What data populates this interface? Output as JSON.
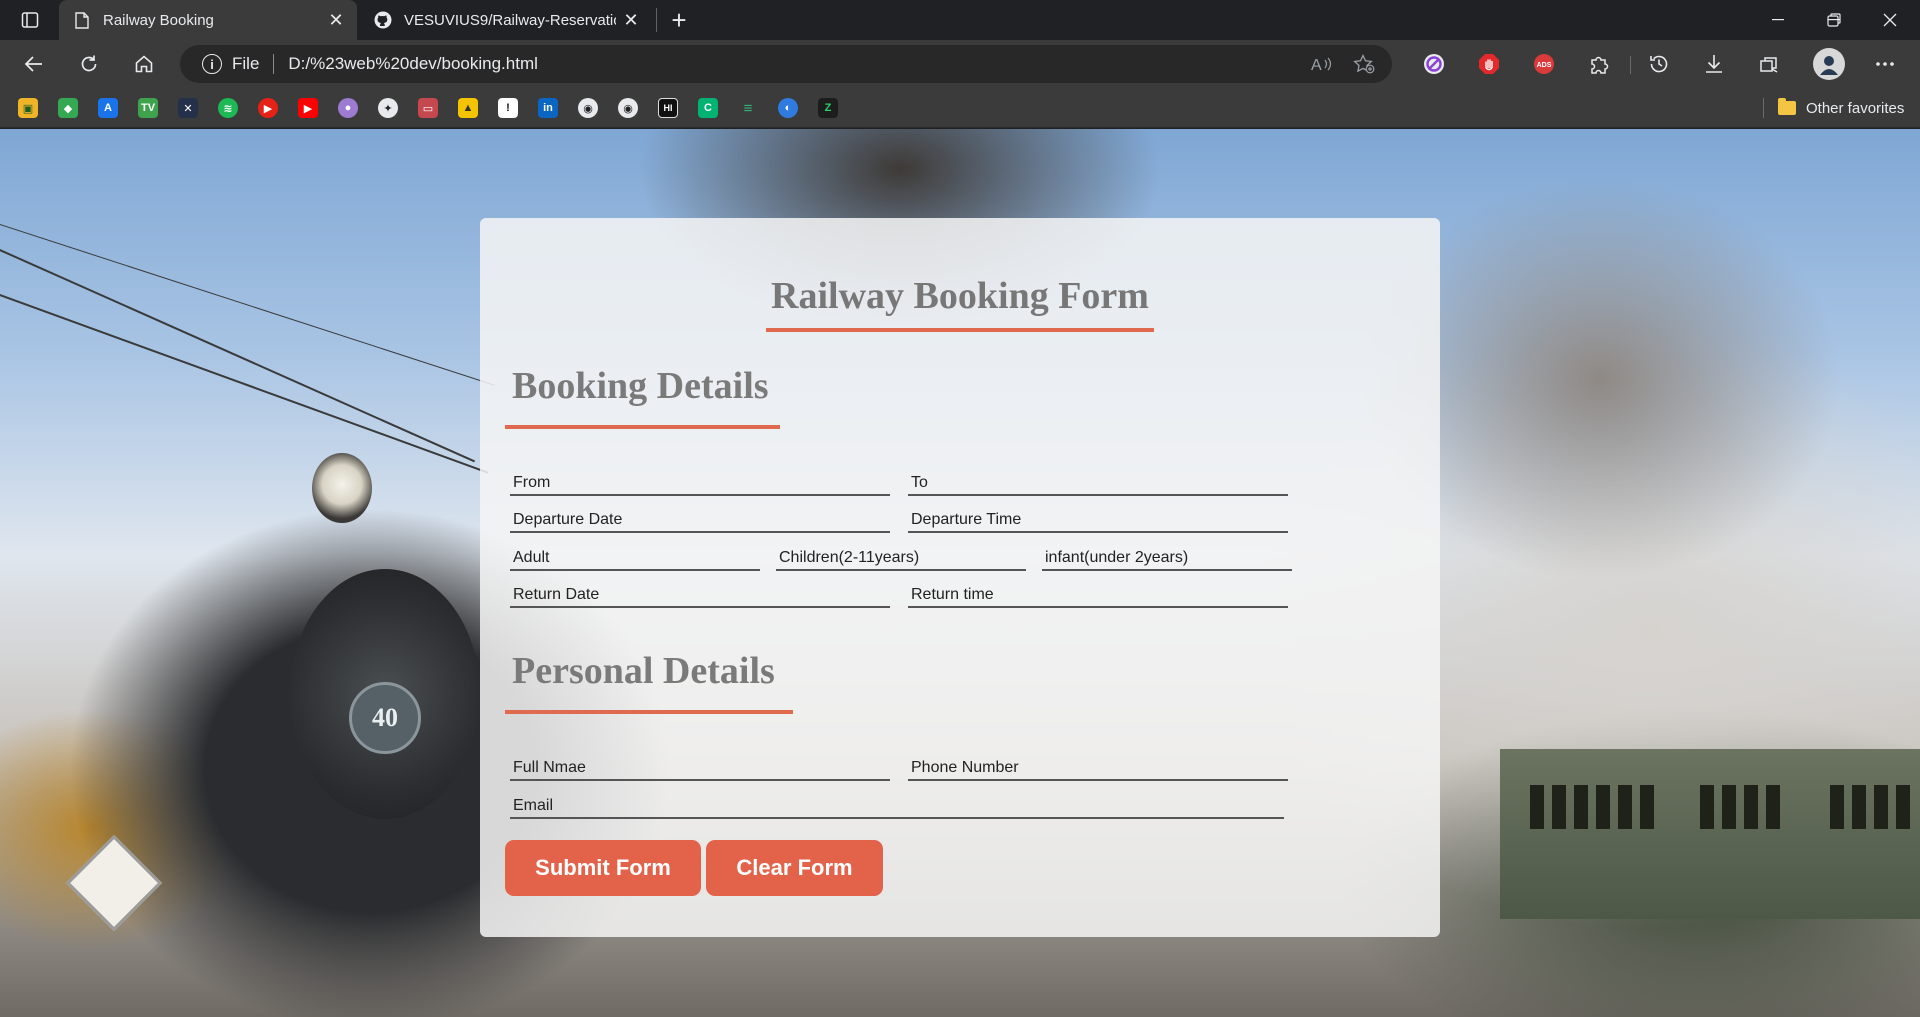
{
  "browser": {
    "tabs": [
      {
        "title": "Railway Booking",
        "active": true
      },
      {
        "title": "VESUVIUS9/Railway-Reservation",
        "active": false
      }
    ],
    "address": {
      "scheme": "File",
      "url": "D:/%23web%20dev/booking.html"
    },
    "bookmarks_other": "Other favorites"
  },
  "form": {
    "title": "Railway Booking Form",
    "booking_section": "Booking Details",
    "personal_section": "Personal Details",
    "fields": {
      "from": "From",
      "to": "To",
      "departure_date": "Departure Date",
      "departure_time": "Departure Time",
      "adult": "Adult",
      "children": "Children(2-11years)",
      "infant": "infant(under 2years)",
      "return_date": "Return Date",
      "return_time": "Return time",
      "full_name": "Full Nmae",
      "phone": "Phone Number",
      "email": "Email"
    },
    "buttons": {
      "submit": "Submit Form",
      "clear": "Clear Form"
    }
  },
  "colors": {
    "accent": "#e2634a",
    "underline": "#e06a4e",
    "heading": "#777777"
  },
  "background": {
    "train_number": "40"
  }
}
